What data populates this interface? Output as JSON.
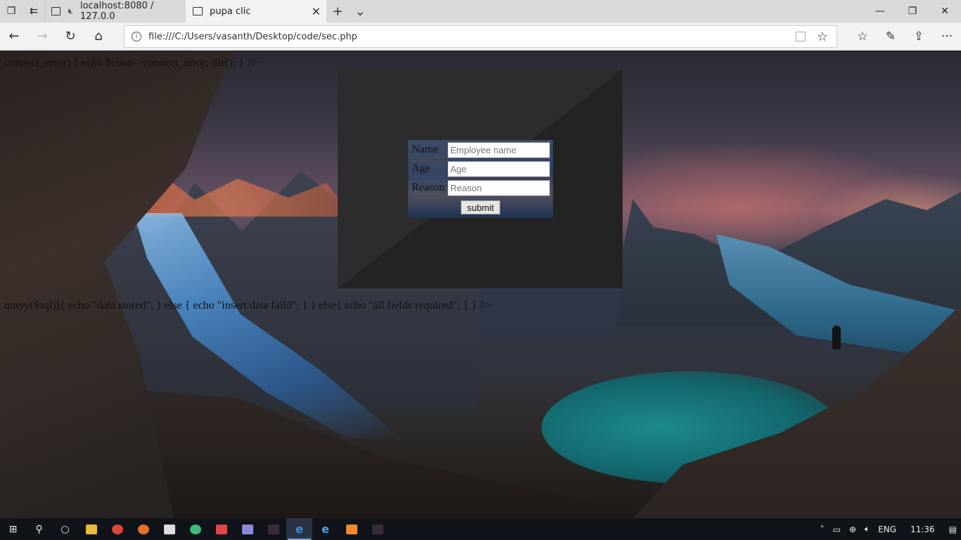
{
  "browser": {
    "tabs": [
      {
        "label": "localhost:8080 / 127.0.0",
        "active": false
      },
      {
        "label": "pupa clic",
        "active": true
      }
    ],
    "address": "file:///C:/Users/vasanth/Desktop/code/sec.php"
  },
  "page": {
    "php_line_top": "connect_error) { echo $conn->connect_error; die(); } ?>",
    "php_line_bottom": "query($sql)){ echo \"data stored\"; } else { echo \"insert data faild\"; } } else{ echo \"all fields required\"; } } ?>",
    "form": {
      "rows": [
        {
          "label": "Name",
          "placeholder": "Employee name"
        },
        {
          "label": "Age",
          "placeholder": "Age"
        },
        {
          "label": "Reason",
          "placeholder": "Reason"
        }
      ],
      "submit_label": "submit"
    }
  },
  "taskbar": {
    "language": "ENG",
    "time": "11:36"
  }
}
